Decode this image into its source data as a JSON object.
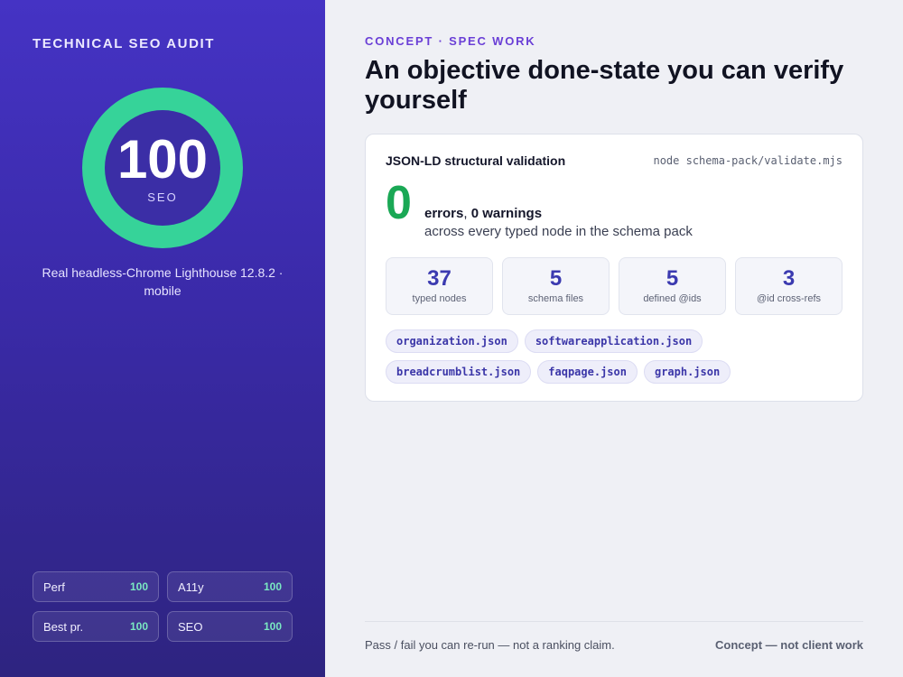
{
  "sidebar": {
    "title": "TECHNICAL SEO AUDIT",
    "gauge": {
      "score": "100",
      "label": "SEO",
      "level_percent": 100
    },
    "caption": "Real headless-Chrome Lighthouse 12.8.2 · mobile",
    "scores": [
      {
        "label": "Perf",
        "value": "100"
      },
      {
        "label": "A11y",
        "value": "100"
      },
      {
        "label": "Best pr.",
        "value": "100"
      },
      {
        "label": "SEO",
        "value": "100"
      }
    ]
  },
  "main": {
    "eyebrow": "CONCEPT · SPEC WORK",
    "headline": "An objective done-state you can verify yourself",
    "card": {
      "title": "JSON-LD structural validation",
      "command": "node schema-pack/validate.mjs",
      "error_count": "0",
      "errors_word": "errors",
      "comma": ", ",
      "warnings": "0 warnings",
      "subtitle": "across every typed node in the schema pack",
      "stats": [
        {
          "value": "37",
          "label": "typed nodes"
        },
        {
          "value": "5",
          "label": "schema files"
        },
        {
          "value": "5",
          "label": "defined @ids"
        },
        {
          "value": "3",
          "label": "@id cross-refs"
        }
      ],
      "files": [
        "organization.json",
        "softwareapplication.json",
        "breadcrumblist.json",
        "faqpage.json",
        "graph.json"
      ]
    },
    "footer": {
      "left": "Pass / fail you can re-run — not a ranking claim.",
      "right": "Concept — not client work"
    }
  },
  "colors": {
    "sidebar_bg": "#4533c4",
    "gauge_ring": "#36d399",
    "accent": "#6a3fd6",
    "success": "#1aa855",
    "stat_number": "#3b3ab0"
  }
}
